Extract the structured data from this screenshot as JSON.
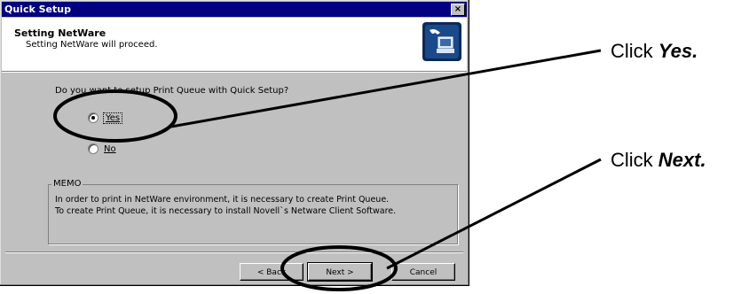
{
  "window": {
    "title": "Quick Setup",
    "close_glyph": "×"
  },
  "header": {
    "title": "Setting NetWare",
    "subtitle": "Setting NetWare will proceed.",
    "icon": "setup-computer-icon"
  },
  "body": {
    "question": "Do you want to setup Print Queue with Quick Setup?",
    "radios": [
      {
        "label": "Yes",
        "selected": true
      },
      {
        "label": "No",
        "selected": false
      }
    ]
  },
  "memo": {
    "legend": "MEMO",
    "lines": [
      "In order to print in NetWare environment, it is necessary to create Print Queue.",
      "To create Print Queue, it is necessary to install Novell`s Netware Client Software."
    ]
  },
  "buttons": {
    "back": "< Back",
    "next": "Next >",
    "cancel": "Cancel"
  },
  "annotations": {
    "click_yes": {
      "prefix": "Click ",
      "emphasis": "Yes."
    },
    "click_next": {
      "prefix": "Click ",
      "emphasis": "Next."
    }
  }
}
